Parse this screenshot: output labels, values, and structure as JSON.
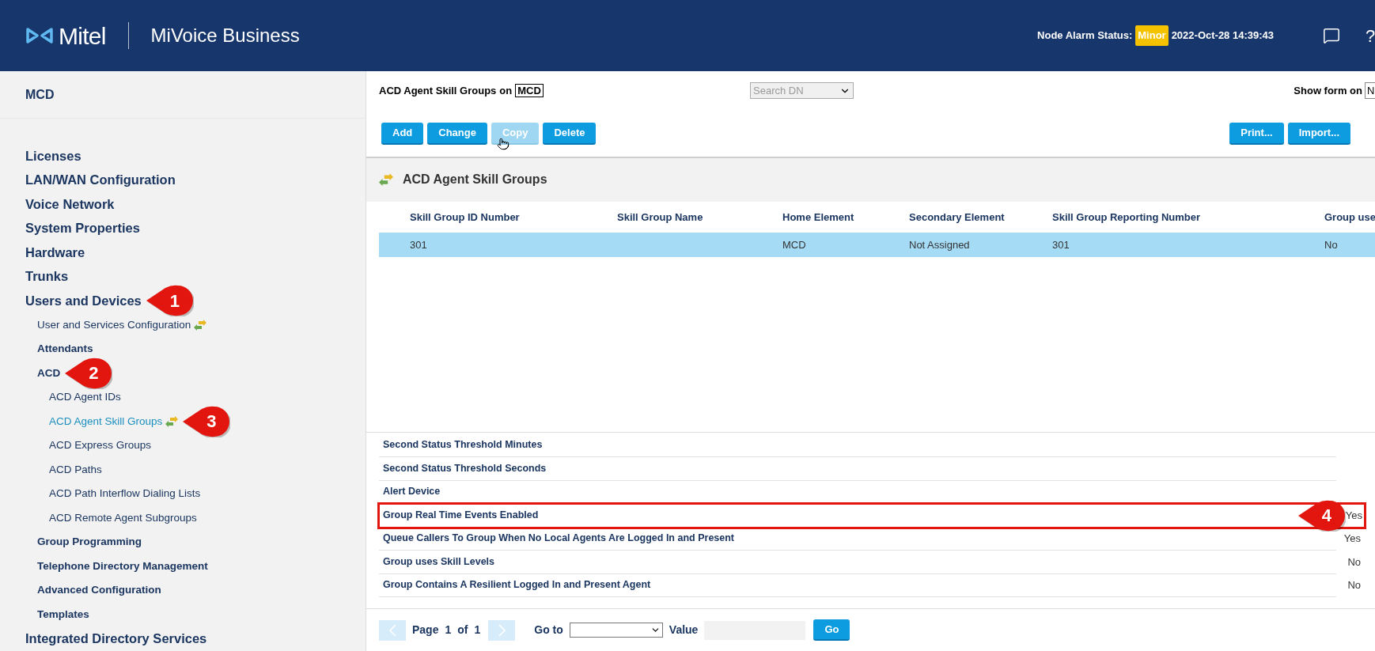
{
  "header": {
    "logo_text": "Mitel",
    "product": "MiVoice Business",
    "alarm_label": "Node Alarm Status:",
    "alarm_status": "Minor",
    "timestamp": "2022-Oct-28 14:39:43",
    "help": "?"
  },
  "sidebar": {
    "title": "MCD",
    "items": [
      {
        "label": "Licenses",
        "kind": "heading",
        "selected": false
      },
      {
        "label": "LAN/WAN Configuration",
        "kind": "heading",
        "selected": false
      },
      {
        "label": "Voice Network",
        "kind": "heading",
        "selected": false
      },
      {
        "label": "System Properties",
        "kind": "heading",
        "selected": false
      },
      {
        "label": "Hardware",
        "kind": "heading",
        "selected": false
      },
      {
        "label": "Trunks",
        "kind": "heading",
        "selected": false
      },
      {
        "label": "Users and Devices",
        "kind": "heading",
        "selected": false,
        "callout": "1",
        "children": [
          {
            "label": "User and Services Configuration",
            "kind": "link",
            "selected": false,
            "shortcut": true
          },
          {
            "label": "Attendants",
            "kind": "heading",
            "selected": false
          },
          {
            "label": "ACD",
            "kind": "heading",
            "selected": false,
            "callout": "2",
            "children": [
              {
                "label": "ACD Agent IDs",
                "kind": "link",
                "selected": false
              },
              {
                "label": "ACD Agent Skill Groups",
                "kind": "link",
                "selected": true,
                "shortcut": true,
                "callout": "3"
              },
              {
                "label": "ACD Express Groups",
                "kind": "link",
                "selected": false
              },
              {
                "label": "ACD Paths",
                "kind": "link",
                "selected": false
              },
              {
                "label": "ACD Path Interflow Dialing Lists",
                "kind": "link",
                "selected": false
              },
              {
                "label": "ACD Remote Agent Subgroups",
                "kind": "link",
                "selected": false
              }
            ]
          },
          {
            "label": "Group Programming",
            "kind": "heading",
            "selected": false
          },
          {
            "label": "Telephone Directory Management",
            "kind": "heading",
            "selected": false
          },
          {
            "label": "Advanced Configuration",
            "kind": "heading",
            "selected": false
          },
          {
            "label": "Templates",
            "kind": "heading",
            "selected": false
          }
        ]
      },
      {
        "label": "Integrated Directory Services",
        "kind": "heading",
        "selected": false
      }
    ]
  },
  "toolbar": {
    "title": "ACD Agent Skill Groups",
    "title_on": "on",
    "element": "MCD",
    "search": {
      "placeholder": "Search DN"
    },
    "show_form_label": "Show form on",
    "show_form_value": "N",
    "buttons": [
      {
        "label": "Add",
        "disabled": false
      },
      {
        "label": "Change",
        "disabled": false
      },
      {
        "label": "Copy",
        "disabled": true
      },
      {
        "label": "Delete",
        "disabled": false
      }
    ],
    "right_buttons": [
      {
        "label": "Print...",
        "disabled": false
      },
      {
        "label": "Import...",
        "disabled": false
      }
    ]
  },
  "section": {
    "title": "ACD Agent Skill Groups"
  },
  "table": {
    "columns": [
      "Skill Group ID Number",
      "Skill Group Name",
      "Home Element",
      "Secondary Element",
      "Skill Group Reporting Number",
      "Group use"
    ],
    "rows": [
      {
        "selected": true,
        "cells": [
          "301",
          "",
          "MCD",
          "Not Assigned",
          "301",
          "No"
        ]
      }
    ]
  },
  "details": [
    {
      "label": "Second Status Threshold Minutes",
      "highlighted": false
    },
    {
      "label": "Second Status Threshold Seconds",
      "highlighted": false
    },
    {
      "label": "Alert Device",
      "highlighted": false
    },
    {
      "label": "Group Real Time Events Enabled",
      "value": "Yes",
      "highlighted": true,
      "callout": "4"
    },
    {
      "label": "Queue Callers To Group When No Local Agents Are Logged In and Present",
      "value": "Yes",
      "highlighted": false
    },
    {
      "label": "Group uses Skill Levels",
      "value": "No",
      "highlighted": false
    },
    {
      "label": "Group Contains A Resilient Logged In and Present Agent",
      "value": "No",
      "highlighted": false
    }
  ],
  "pagination": {
    "page_label": "Page",
    "page": "1",
    "of_label": "of",
    "total": "1",
    "prev_disabled": true,
    "next_disabled": true,
    "goto_label": "Go to",
    "value_label": "Value",
    "go_button": "Go"
  }
}
